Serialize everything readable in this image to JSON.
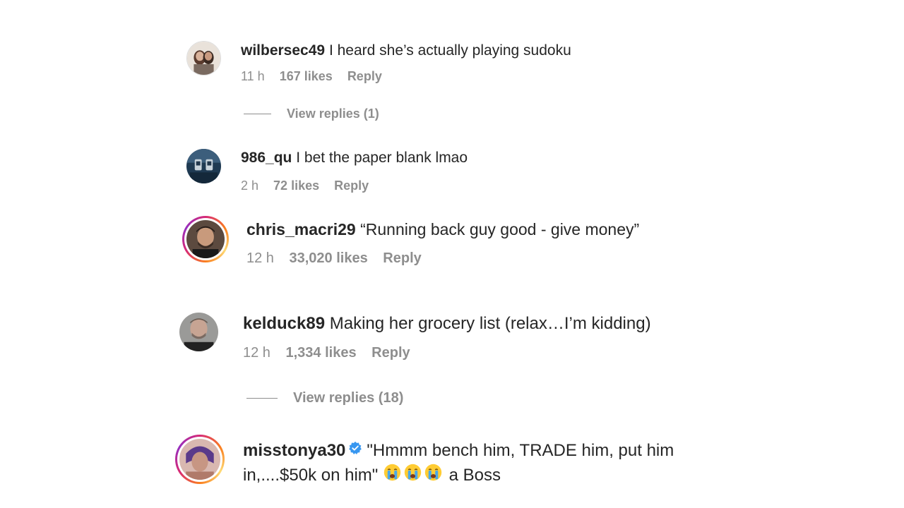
{
  "comments": [
    {
      "username": "wilbersec49",
      "text": "I heard she’s actually playing sudoku",
      "time": "11 h",
      "likes": "167 likes",
      "reply": "Reply",
      "view_replies": "View replies (1)"
    },
    {
      "username": "986_qu",
      "text": "I bet the paper blank lmao",
      "time": "2 h",
      "likes": "72 likes",
      "reply": "Reply"
    },
    {
      "username": "chris_macri29",
      "text": "“Running back guy good - give money”",
      "time": "12 h",
      "likes": "33,020 likes",
      "reply": "Reply"
    },
    {
      "username": "kelduck89",
      "text": "Making her grocery list (relax…I’m kidding)",
      "time": "12 h",
      "likes": "1,334 likes",
      "reply": "Reply",
      "view_replies": "View replies (18)"
    },
    {
      "username": "misstonya30",
      "text_line1": "\"Hmmm bench him, TRADE him, put him",
      "text_line2_start": "in,....$50k on him\"",
      "text_line2_end": "a Boss"
    }
  ],
  "icons": {
    "verified": "verified-badge-icon",
    "emoji": "loudly-crying-face-emoji"
  },
  "colors": {
    "text": "#262626",
    "secondary": "#8e8e8e",
    "verified": "#0095f6"
  }
}
